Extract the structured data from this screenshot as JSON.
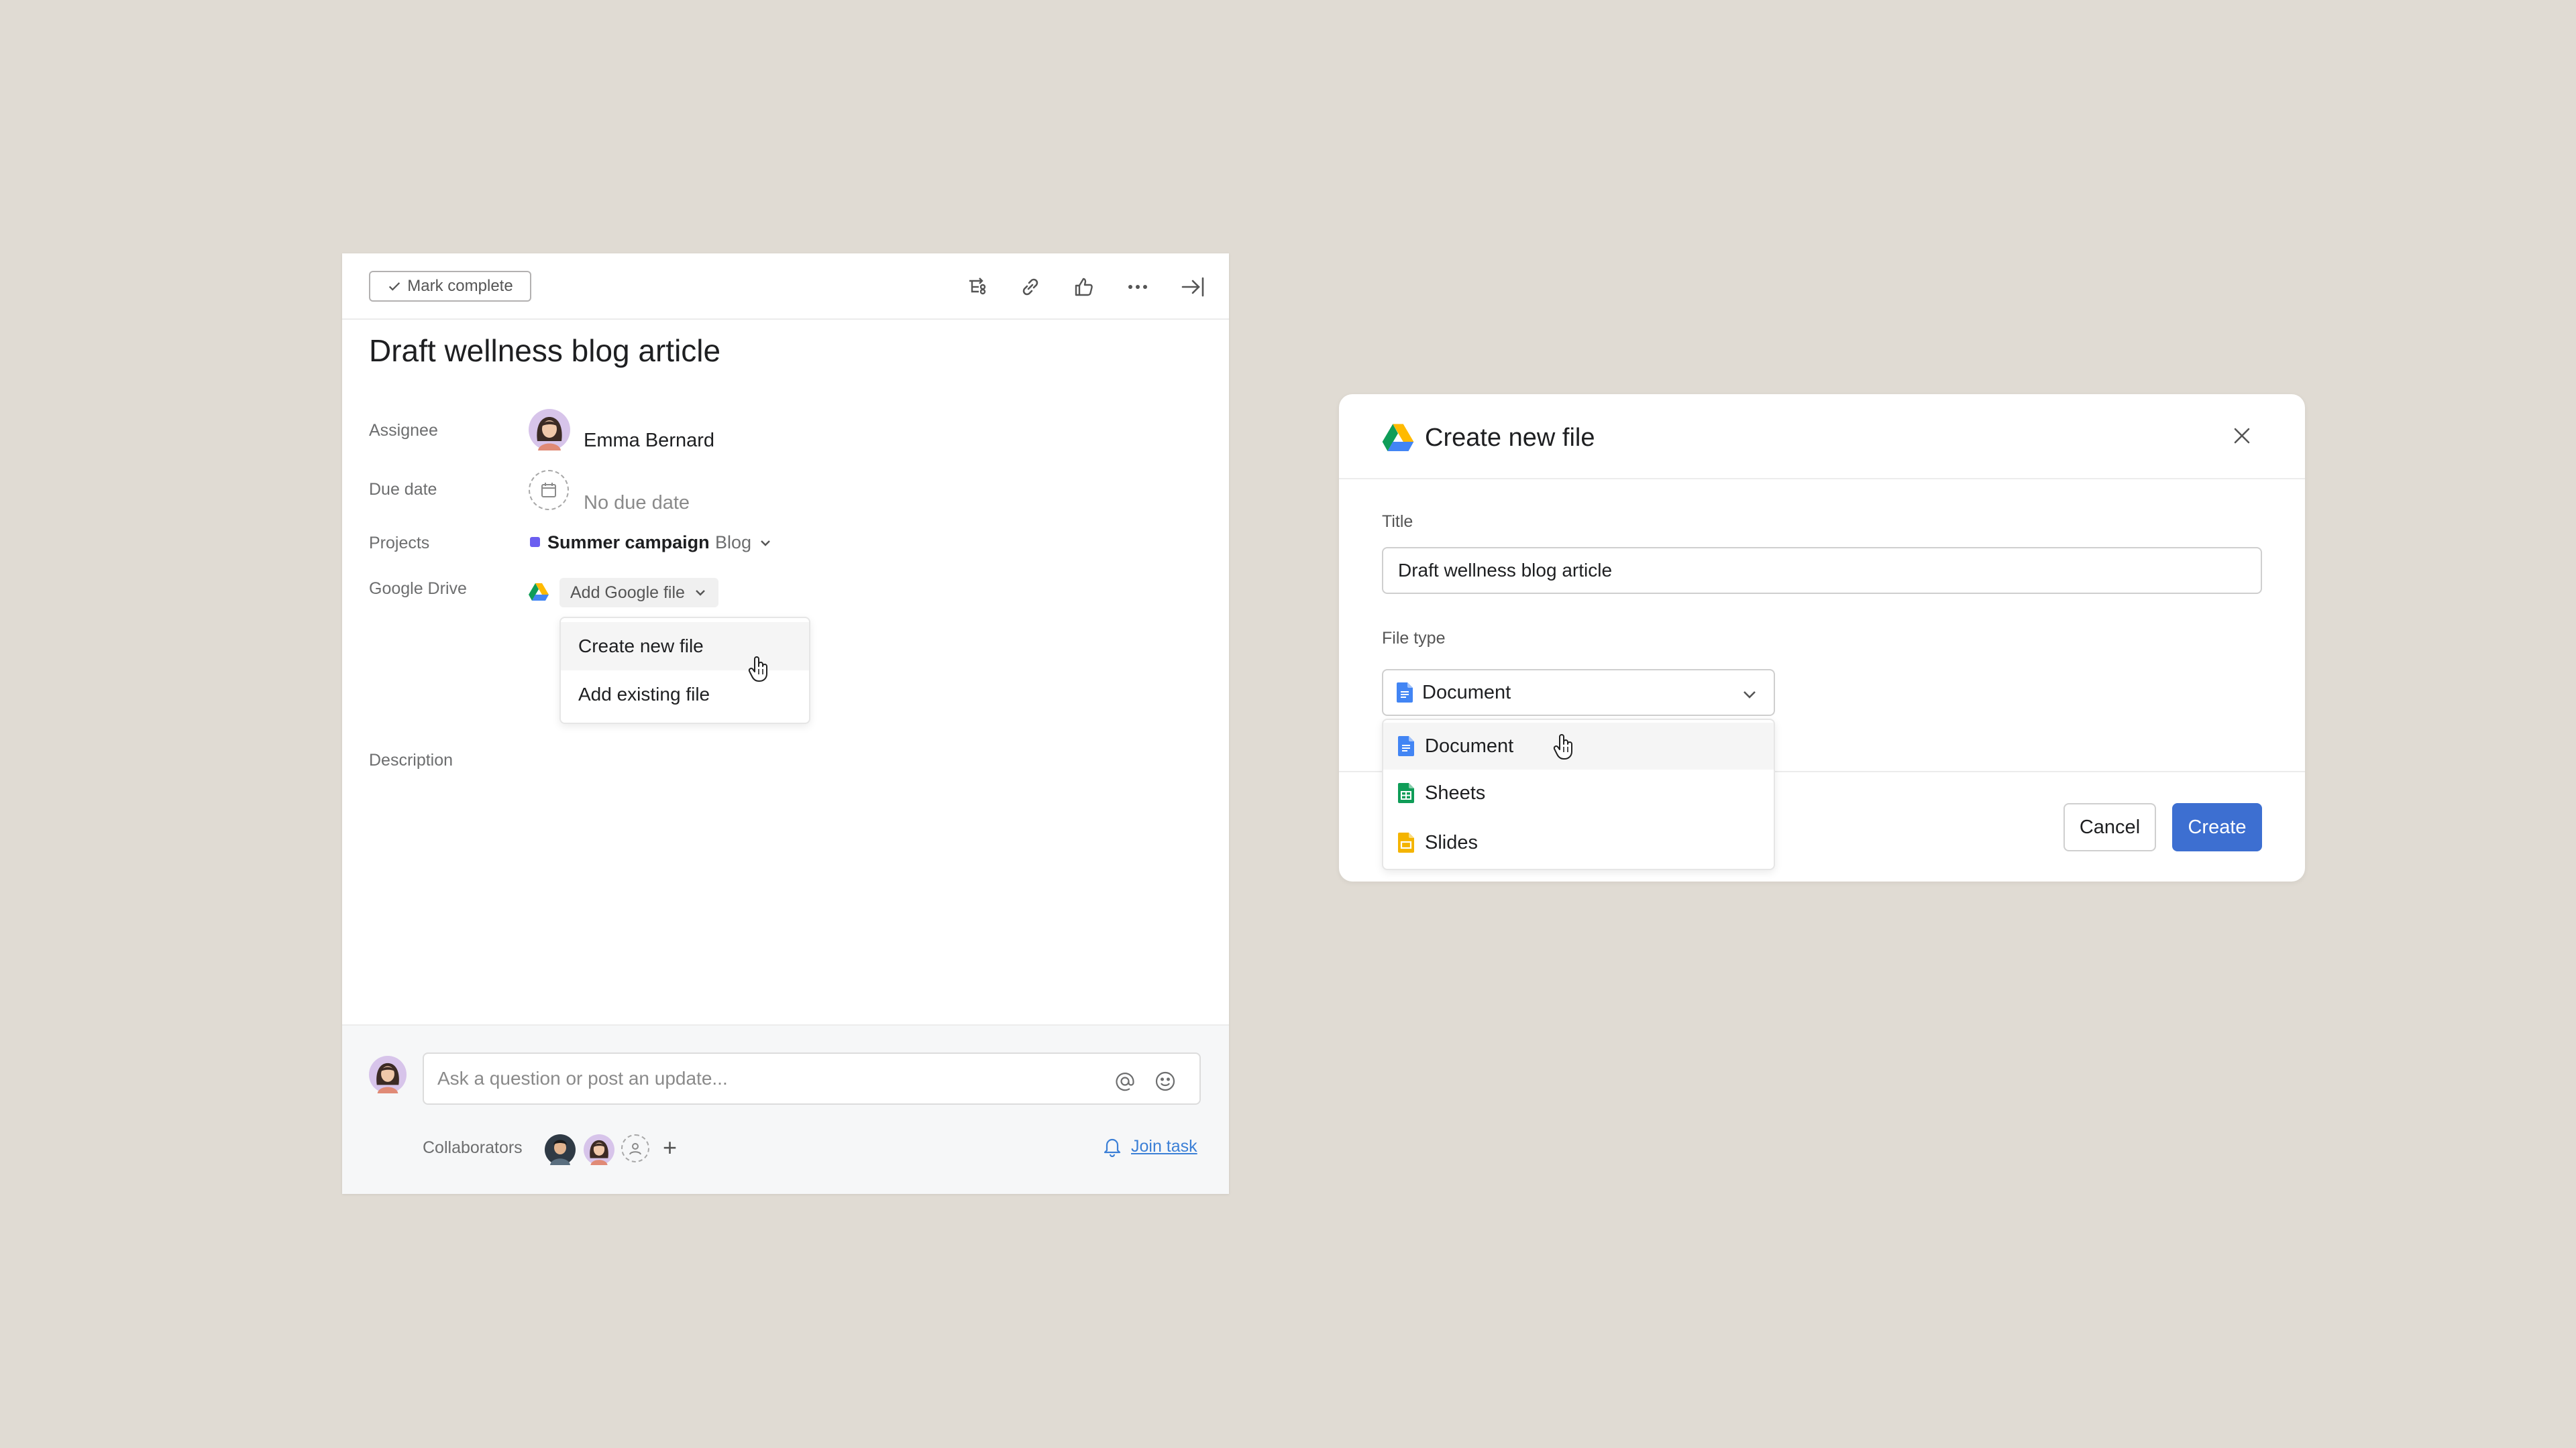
{
  "task": {
    "mark_complete_label": "Mark complete",
    "title": "Draft wellness blog article",
    "fields": {
      "assignee_label": "Assignee",
      "assignee_name": "Emma Bernard",
      "due_date_label": "Due date",
      "due_date_value": "No due date",
      "projects_label": "Projects",
      "project_name": "Summer campaign",
      "project_section": "Blog",
      "google_drive_label": "Google Drive",
      "add_google_file_label": "Add Google file",
      "description_label": "Description"
    },
    "drive_menu": {
      "items": [
        "Create new file",
        "Add existing file"
      ]
    },
    "comment": {
      "placeholder": "Ask a question or post an update...",
      "collaborators_label": "Collaborators",
      "join_task_label": "Join task"
    }
  },
  "dialog": {
    "title": "Create new file",
    "title_field_label": "Title",
    "title_field_value": "Draft wellness blog article",
    "file_type_label": "File type",
    "file_type_selected": "Document",
    "file_type_options": [
      "Document",
      "Sheets",
      "Slides"
    ],
    "cancel_label": "Cancel",
    "create_label": "Create"
  },
  "colors": {
    "background": "#e0dbd3",
    "project_dot": "#6b5ef0",
    "primary_button": "#3d6fd1",
    "link": "#3b7fd6",
    "docs_blue": "#4285f4",
    "sheets_green": "#0f9d58",
    "slides_yellow": "#f4b400"
  },
  "icons": {
    "toolbar": [
      "subtask-icon",
      "link-icon",
      "thumbs-up-icon",
      "more-icon",
      "close-panel-icon"
    ]
  }
}
